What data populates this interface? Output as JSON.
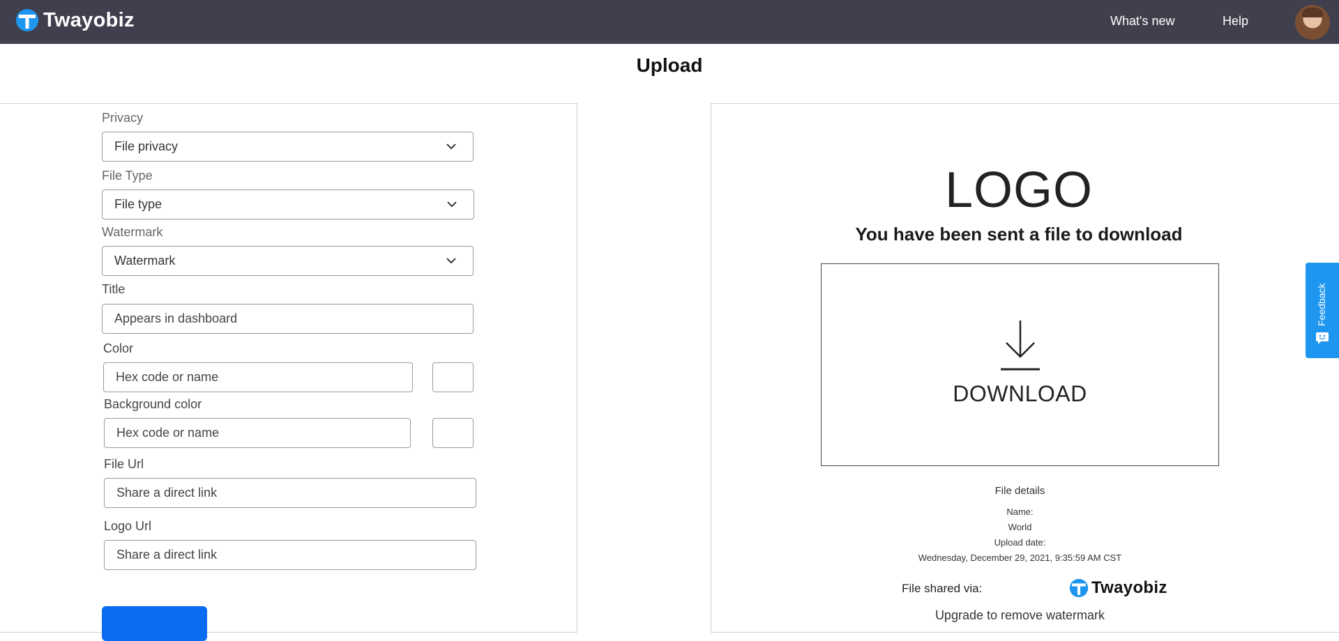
{
  "header": {
    "brand": "Twayobiz",
    "nav": [
      "What's new",
      "Help"
    ]
  },
  "page": {
    "title": "Upload"
  },
  "form": {
    "privacy_label": "Privacy",
    "privacy_value": "File privacy",
    "filetype_label": "File Type",
    "filetype_value": "File type",
    "watermark_label": "Watermark",
    "watermark_value": "Watermark",
    "title_label": "Title",
    "title_placeholder": "Appears in dashboard",
    "color_label": "Color",
    "color_placeholder": "Hex code or name",
    "bgcolor_label": "Background color",
    "bgcolor_placeholder": "Hex code or name",
    "fileurl_label": "File Url",
    "fileurl_placeholder": "Share a direct link",
    "logourl_label": "Logo Url",
    "logourl_placeholder": "Share a direct link"
  },
  "preview": {
    "logo": "LOGO",
    "subtitle": "You have been sent a file to download",
    "download": "DOWNLOAD",
    "details_title": "File details",
    "name_label": "Name:",
    "name_value": "World",
    "date_label": "Upload date:",
    "date_value": "Wednesday, December 29, 2021, 9:35:59 AM CST",
    "shared_label": "File shared via:",
    "shared_brand": "Twayobiz",
    "upgrade": "Upgrade to remove watermark"
  },
  "feedback": {
    "label": "Feedback"
  },
  "colors": {
    "topbar": "#3f3f4e",
    "brand_blue": "#1e96f0",
    "button_blue": "#0a6cf0"
  }
}
